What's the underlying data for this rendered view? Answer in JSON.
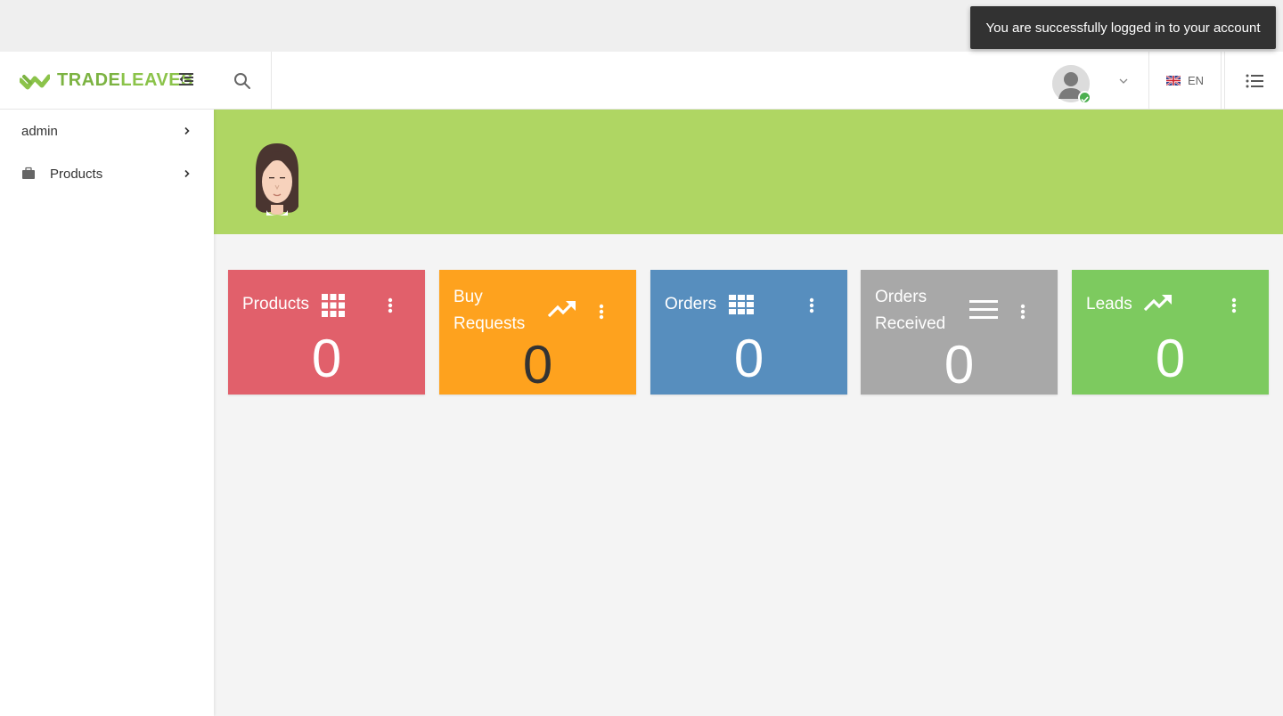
{
  "toast": {
    "message": "You are successfully logged in to your account"
  },
  "brand": {
    "name_part1": "TRADE",
    "name_part2": "LEAVES"
  },
  "header": {
    "language_code": "EN"
  },
  "sidebar": {
    "items": [
      {
        "label": "admin"
      },
      {
        "label": "Products"
      }
    ]
  },
  "cards": [
    {
      "title": "Products",
      "value": "0",
      "color": "#e1606b",
      "icon": "grid-icon"
    },
    {
      "title_line1": "Buy",
      "title_line2": "Requests",
      "value": "0",
      "color": "#fea21e",
      "icon": "trending-up-icon"
    },
    {
      "title": "Orders",
      "value": "0",
      "color": "#578ebe",
      "icon": "table-icon"
    },
    {
      "title_line1": "Orders",
      "title_line2": "Received",
      "value": "0",
      "color": "#a8a8a8",
      "icon": "list-icon"
    },
    {
      "title": "Leads",
      "value": "0",
      "color": "#7dca5f",
      "icon": "trending-up-icon"
    }
  ],
  "colors": {
    "banner": "#afd663",
    "brand_green": "#8bc34a",
    "status_online": "#4caf50"
  }
}
